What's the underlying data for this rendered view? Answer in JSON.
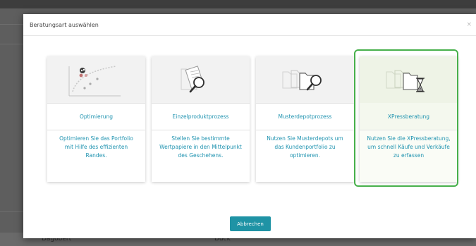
{
  "dialog": {
    "title": "Beratungsart auswählen",
    "close_glyph": "×",
    "cancel_label": "Abbrechen"
  },
  "cards": [
    {
      "title": "Optimierung",
      "description": "Optimieren Sie das Portfolio mit Hilfe des effizienten Randes.",
      "icon": "efficient-frontier-icon",
      "selected": false
    },
    {
      "title": "Einzelproduktprozess",
      "description": "Stellen Sie bestimmte Wertpapiere in den Mittelpunkt des Geschehens.",
      "icon": "document-magnifier-icon",
      "selected": false
    },
    {
      "title": "Musterdepotprozess",
      "description": "Nutzen Sie Musterdepots um das Kundenportfolio zu optimieren.",
      "icon": "folders-magnifier-icon",
      "selected": false
    },
    {
      "title": "XPressberatung",
      "description": "Nutzen Sie die XPressberatung, um schnell Käufe und Verkäufe zu erfassen",
      "icon": "folders-hourglass-icon",
      "selected": true
    }
  ],
  "background": {
    "row_text_1": "Dagobert",
    "row_text_2": "Duck"
  },
  "colors": {
    "accent": "#1f93b0",
    "button": "#1f93a5",
    "selection_border": "#47b04b"
  }
}
